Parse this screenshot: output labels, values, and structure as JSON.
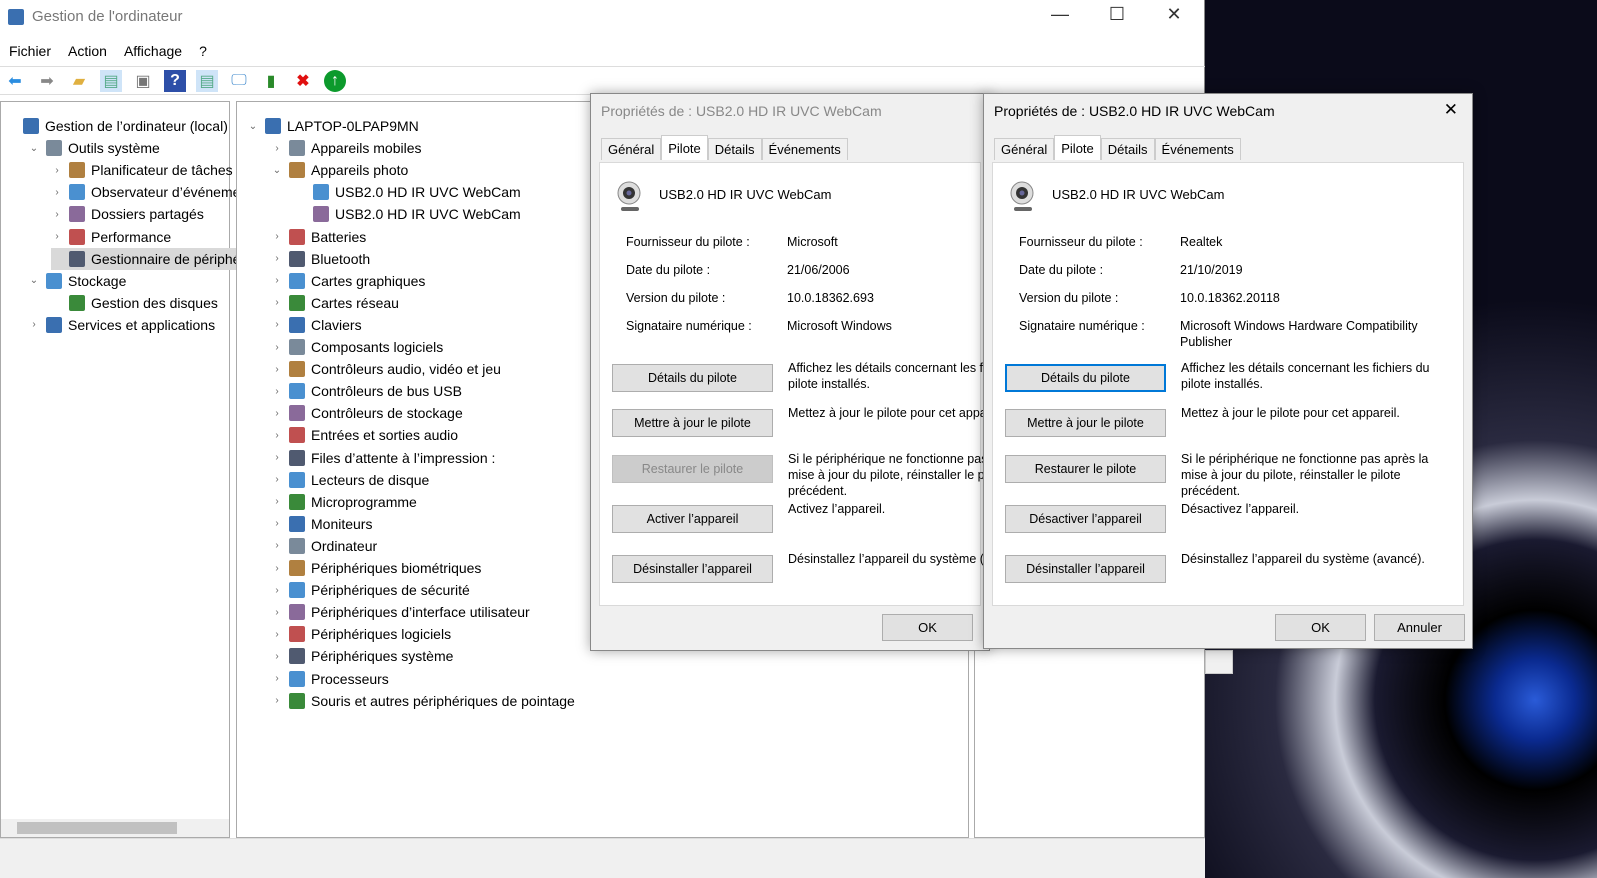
{
  "window": {
    "title": "Gestion de l'ordinateur",
    "minimize": "—",
    "maximize": "☐",
    "close": "✕"
  },
  "menu": [
    "Fichier",
    "Action",
    "Affichage",
    "?"
  ],
  "toolbar": [
    "back-icon",
    "forward-icon",
    "up-folder-icon",
    "show-hide-tree-icon",
    "properties-icon",
    "help-icon",
    "show-hide-action-icon",
    "scan-hardware-icon",
    "update-driver-icon",
    "uninstall-icon",
    "enable-icon"
  ],
  "left_tree": [
    {
      "label": "Gestion de l’ordinateur (local)",
      "level": 0,
      "exp": ""
    },
    {
      "label": "Outils système",
      "level": 1,
      "exp": "⌄"
    },
    {
      "label": "Planificateur de tâches",
      "level": 2,
      "exp": "›"
    },
    {
      "label": "Observateur d’événements",
      "level": 2,
      "exp": "›"
    },
    {
      "label": "Dossiers partagés",
      "level": 2,
      "exp": "›"
    },
    {
      "label": "Performance",
      "level": 2,
      "exp": "›"
    },
    {
      "label": "Gestionnaire de périphériques",
      "level": 2,
      "exp": "",
      "selected": true
    },
    {
      "label": "Stockage",
      "level": 1,
      "exp": "⌄"
    },
    {
      "label": "Gestion des disques",
      "level": 2,
      "exp": ""
    },
    {
      "label": "Services et applications",
      "level": 1,
      "exp": "›"
    }
  ],
  "device_tree": [
    {
      "label": "LAPTOP-0LPAP9MN",
      "level": 0,
      "exp": "⌄"
    },
    {
      "label": "Appareils mobiles",
      "level": 1,
      "exp": "›"
    },
    {
      "label": "Appareils photo",
      "level": 1,
      "exp": "⌄"
    },
    {
      "label": "USB2.0 HD IR UVC WebCam",
      "level": 2,
      "exp": ""
    },
    {
      "label": "USB2.0 HD IR UVC WebCam",
      "level": 2,
      "exp": ""
    },
    {
      "label": "Batteries",
      "level": 1,
      "exp": "›"
    },
    {
      "label": "Bluetooth",
      "level": 1,
      "exp": "›"
    },
    {
      "label": "Cartes graphiques",
      "level": 1,
      "exp": "›"
    },
    {
      "label": "Cartes réseau",
      "level": 1,
      "exp": "›"
    },
    {
      "label": "Claviers",
      "level": 1,
      "exp": "›"
    },
    {
      "label": "Composants logiciels",
      "level": 1,
      "exp": "›"
    },
    {
      "label": "Contrôleurs audio, vidéo et jeu",
      "level": 1,
      "exp": "›"
    },
    {
      "label": "Contrôleurs de bus USB",
      "level": 1,
      "exp": "›"
    },
    {
      "label": "Contrôleurs de stockage",
      "level": 1,
      "exp": "›"
    },
    {
      "label": "Entrées et sorties audio",
      "level": 1,
      "exp": "›"
    },
    {
      "label": "Files d’attente à l’impression :",
      "level": 1,
      "exp": "›"
    },
    {
      "label": "Lecteurs de disque",
      "level": 1,
      "exp": "›"
    },
    {
      "label": "Microprogramme",
      "level": 1,
      "exp": "›"
    },
    {
      "label": "Moniteurs",
      "level": 1,
      "exp": "›"
    },
    {
      "label": "Ordinateur",
      "level": 1,
      "exp": "›"
    },
    {
      "label": "Périphériques biométriques",
      "level": 1,
      "exp": "›"
    },
    {
      "label": "Périphériques de sécurité",
      "level": 1,
      "exp": "›"
    },
    {
      "label": "Périphériques d’interface utilisateur",
      "level": 1,
      "exp": "›"
    },
    {
      "label": "Périphériques logiciels",
      "level": 1,
      "exp": "›"
    },
    {
      "label": "Périphériques système",
      "level": 1,
      "exp": "›"
    },
    {
      "label": "Processeurs",
      "level": 1,
      "exp": "›"
    },
    {
      "label": "Souris et autres périphériques de pointage",
      "level": 1,
      "exp": "›"
    }
  ],
  "dialogs": [
    {
      "title": "Propriétés de : USB2.0 HD IR UVC WebCam",
      "tabs": [
        "Général",
        "Pilote",
        "Détails",
        "Événements"
      ],
      "device": "USB2.0 HD IR UVC WebCam",
      "fields": [
        [
          "Fournisseur du pilote :",
          "Microsoft"
        ],
        [
          "Date du pilote :",
          "21/06/2006"
        ],
        [
          "Version du pilote :",
          "10.0.18362.693"
        ],
        [
          "Signataire numérique :",
          "Microsoft Windows"
        ]
      ],
      "buttons": [
        [
          "Détails du pilote",
          "Affichez les détails concernant les fichiers du pilote installés."
        ],
        [
          "Mettre à jour le pilote",
          "Mettez à jour le pilote pour cet appareil."
        ],
        [
          "Restaurer le pilote",
          "Si le périphérique ne fonctionne pas après la mise à jour du pilote, réinstaller le pilote précédent."
        ],
        [
          "Activer l’appareil",
          "Activez l’appareil."
        ],
        [
          "Désinstaller l’appareil",
          "Désinstallez l’appareil du système (avancé)."
        ]
      ],
      "ok": "OK"
    },
    {
      "title": "Propriétés de : USB2.0 HD IR UVC WebCam",
      "tabs": [
        "Général",
        "Pilote",
        "Détails",
        "Événements"
      ],
      "device": "USB2.0 HD IR UVC WebCam",
      "fields": [
        [
          "Fournisseur du pilote :",
          "Realtek"
        ],
        [
          "Date du pilote :",
          "21/10/2019"
        ],
        [
          "Version du pilote :",
          "10.0.18362.20118"
        ],
        [
          "Signataire numérique :",
          "Microsoft Windows Hardware Compatibility Publisher"
        ]
      ],
      "buttons": [
        [
          "Détails du pilote",
          "Affichez les détails concernant les fichiers du pilote installés."
        ],
        [
          "Mettre à jour le pilote",
          "Mettez à jour le pilote pour cet appareil."
        ],
        [
          "Restaurer le pilote",
          "Si le périphérique ne fonctionne pas après la mise à jour du pilote, réinstaller le pilote précédent."
        ],
        [
          "Désactiver l’appareil",
          "Désactivez l’appareil."
        ],
        [
          "Désinstaller l’appareil",
          "Désinstallez l’appareil du système (avancé)."
        ]
      ],
      "ok": "OK",
      "cancel": "Annuler",
      "close": "✕"
    }
  ]
}
